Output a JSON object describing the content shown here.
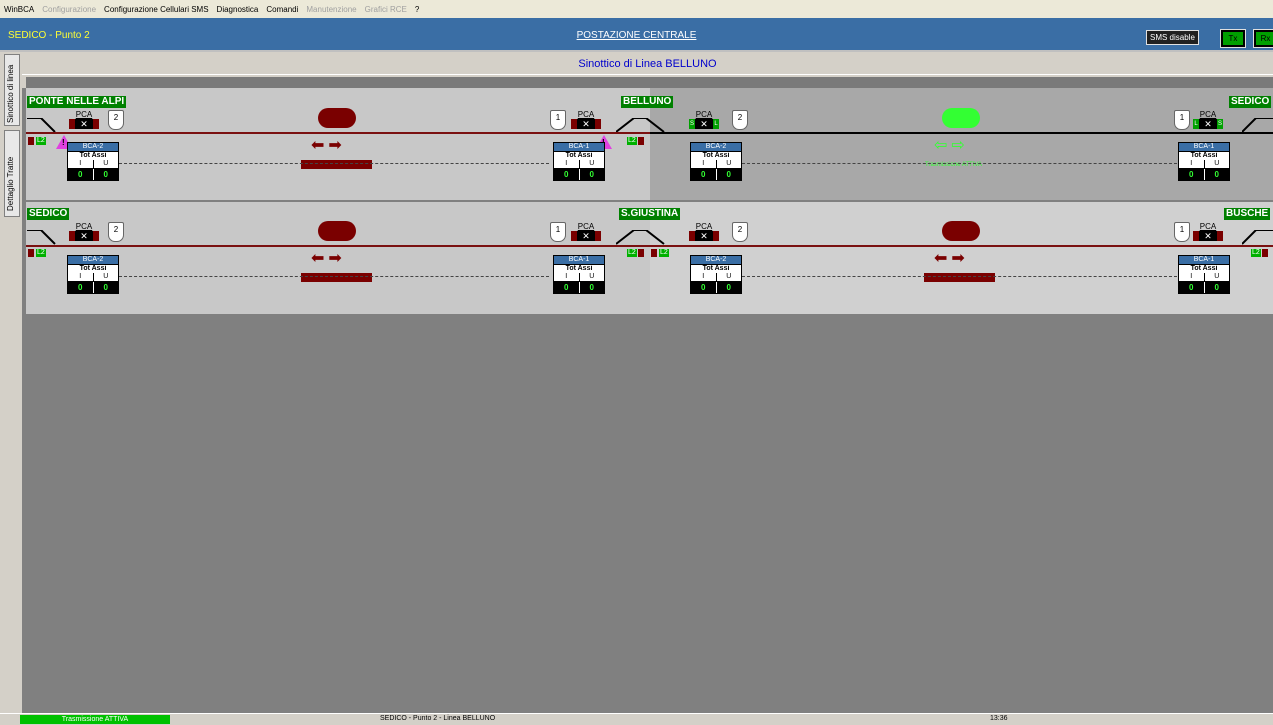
{
  "menu": {
    "items": [
      {
        "label": "WinBCA",
        "enabled": true
      },
      {
        "label": "Configurazione",
        "enabled": false
      },
      {
        "label": "Configurazione Cellulari SMS",
        "enabled": true
      },
      {
        "label": "Diagnostica",
        "enabled": true
      },
      {
        "label": "Comandi",
        "enabled": true
      },
      {
        "label": "Manutenzione",
        "enabled": false
      },
      {
        "label": "Grafici RCE",
        "enabled": false
      },
      {
        "label": "?",
        "enabled": true
      }
    ]
  },
  "titlebar": {
    "left": "SEDICO - Punto 2",
    "center": "POSTAZIONE CENTRALE",
    "sms": "SMS disable",
    "tx": "Tx",
    "rx": "Rx"
  },
  "vtabs": {
    "tab1": "Sinottico di linea",
    "tab2": "Dettaglio Tratte"
  },
  "subheader": "Sinottico di Linea BELLUNO",
  "row1": {
    "left_station": "PONTE NELLE ALPI",
    "mid_station": "BELLUNO",
    "right_station": "SEDICO",
    "transmission": "Trasmissione ATTIVA"
  },
  "row2": {
    "left_station": "SEDICO",
    "mid_station": "S.GIUSTINA",
    "right_station": "BUSCHE"
  },
  "labels": {
    "pca": "PCA",
    "bca1": "BCA-1",
    "bca2": "BCA-2",
    "tot": "Tot Assi",
    "i": "I",
    "u": "U",
    "zero": "0",
    "one": "1",
    "two": "2",
    "l2": "L2",
    "s": "S",
    "l": "L",
    "warn": "!"
  },
  "counters": {
    "row1_c1_i": "0",
    "row1_c1_u": "0"
  },
  "colors": {
    "track_red": "#7a1010",
    "active_green": "#33ff33",
    "station_green": "#008000"
  },
  "statusbar": {
    "left": "Trasmissione ATTIVA",
    "center": "SEDICO - Punto 2 - Linea BELLUNO",
    "right": "13:36"
  }
}
